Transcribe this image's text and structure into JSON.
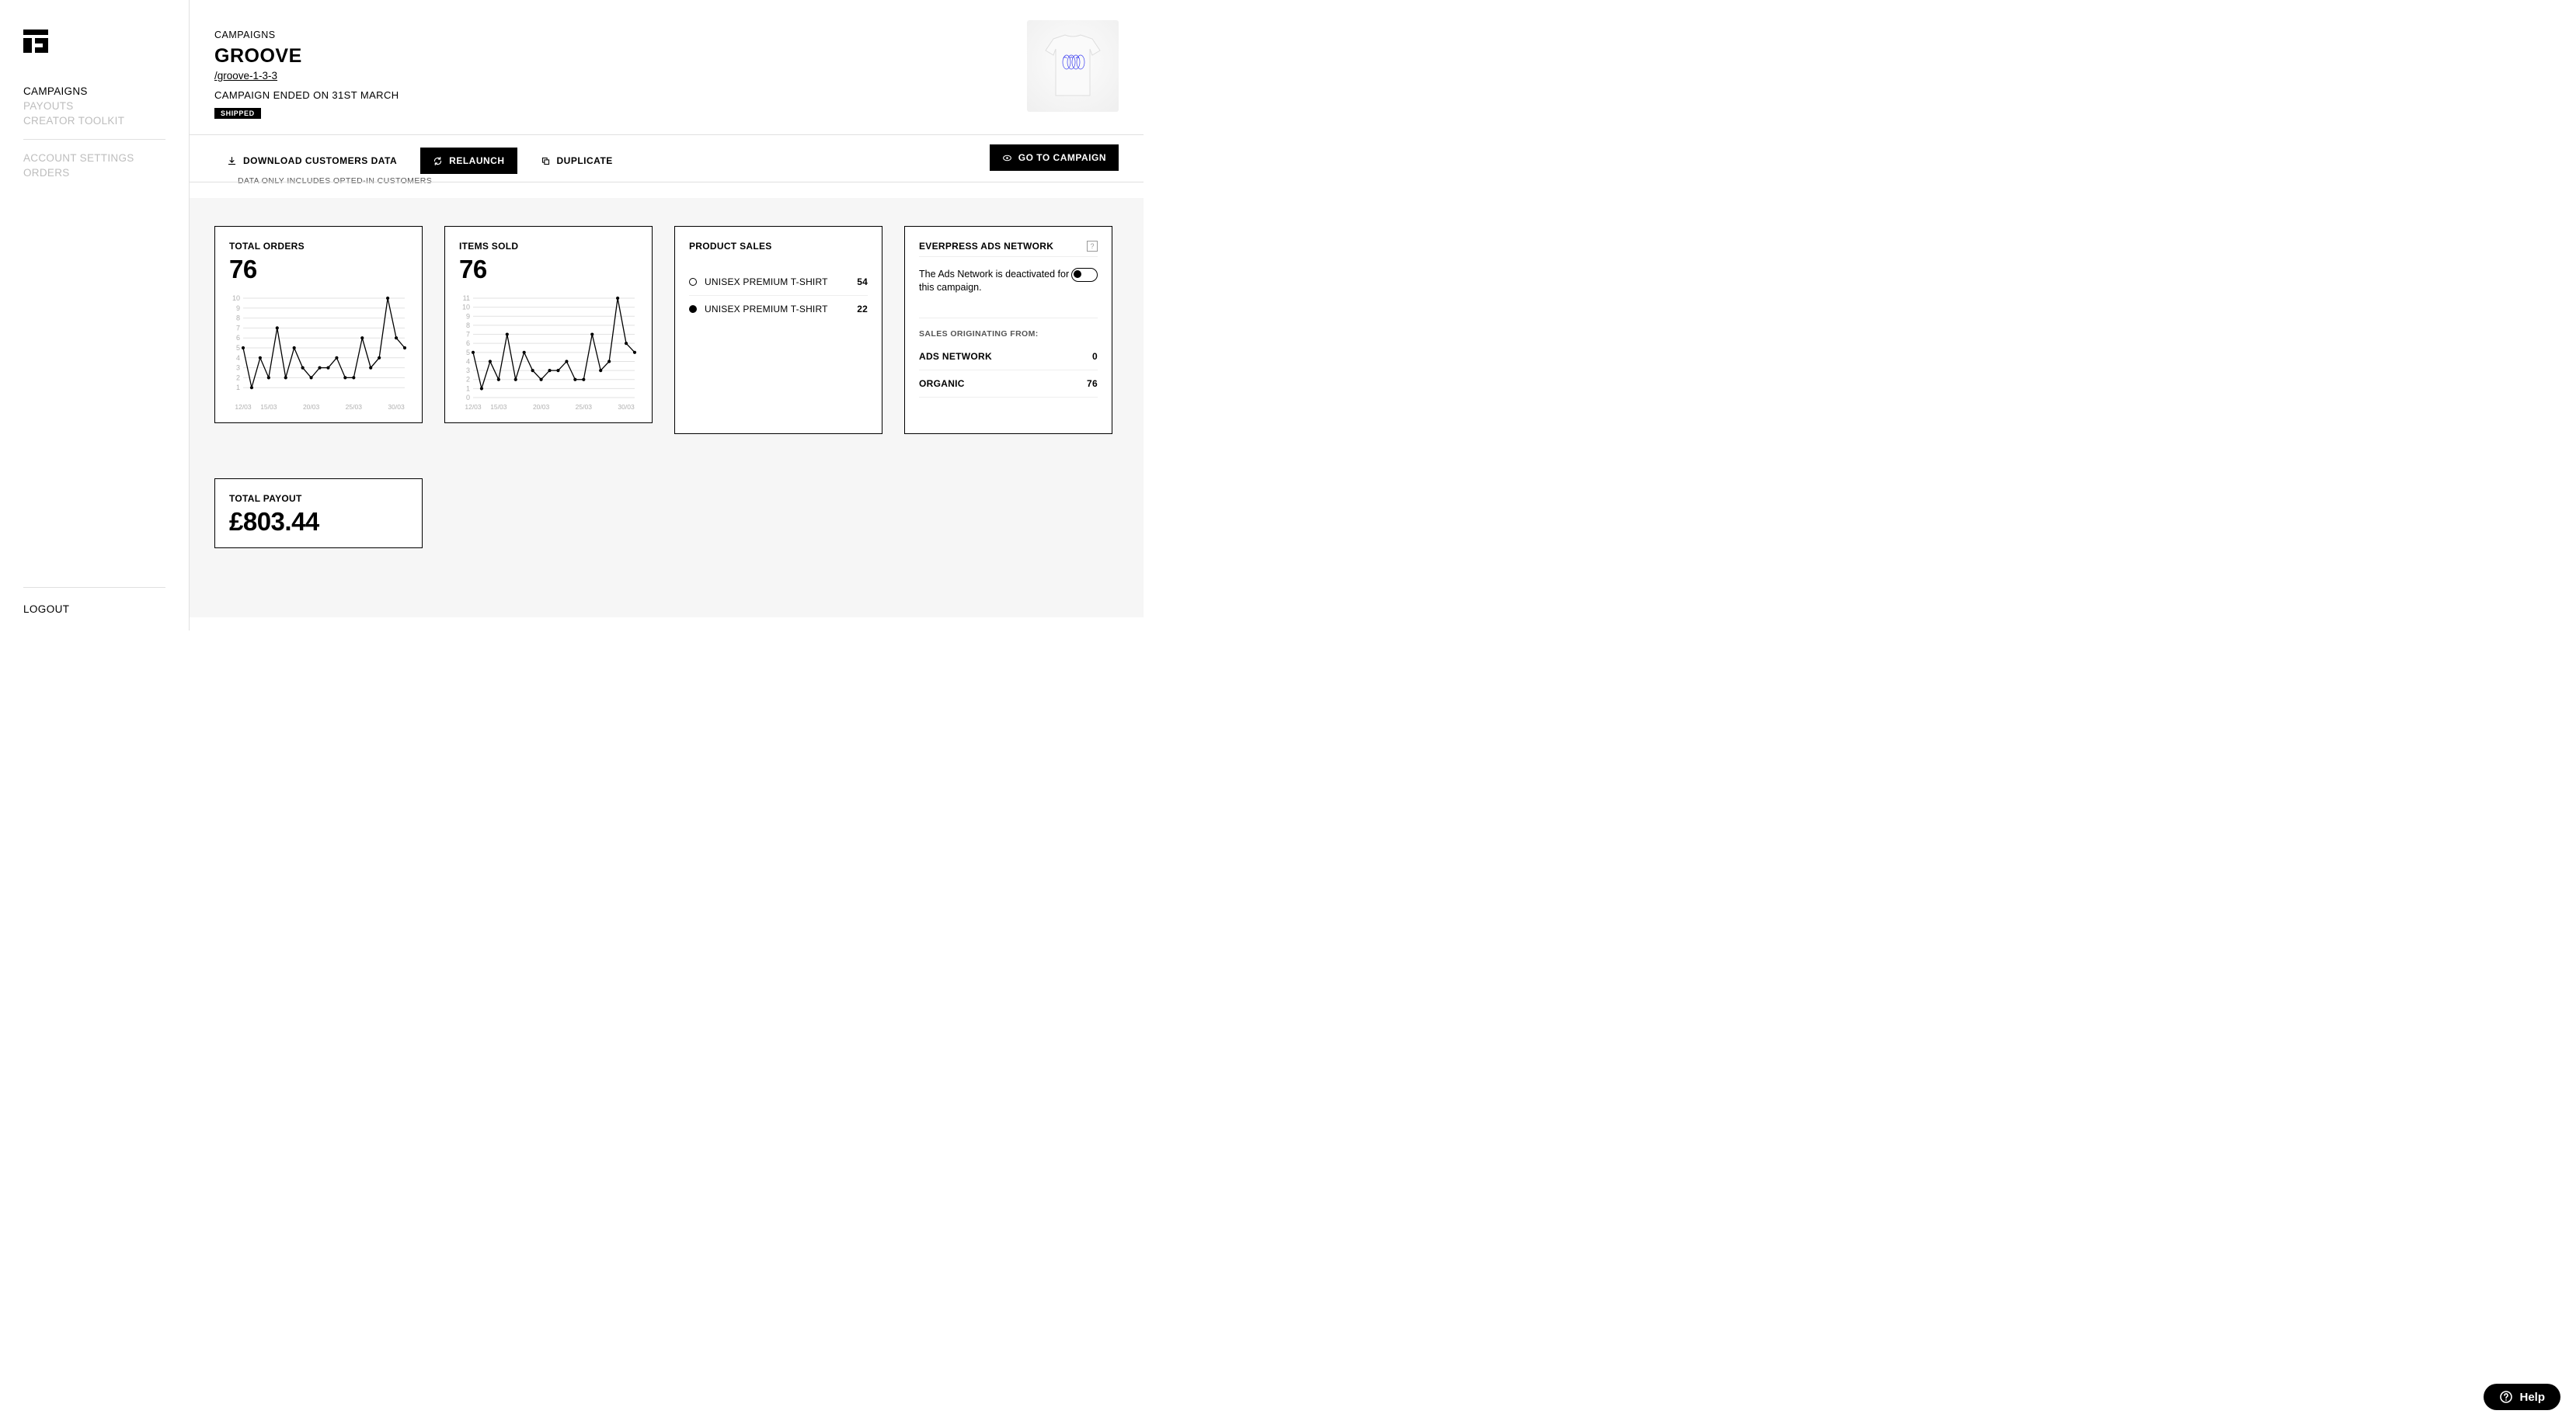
{
  "sidebar": {
    "items": [
      {
        "label": "CAMPAIGNS",
        "active": true
      },
      {
        "label": "PAYOUTS"
      },
      {
        "label": "CREATOR TOOLKIT"
      }
    ],
    "items2": [
      {
        "label": "ACCOUNT SETTINGS"
      },
      {
        "label": "ORDERS"
      }
    ],
    "logout": "LOGOUT"
  },
  "header": {
    "breadcrumb": "CAMPAIGNS",
    "title": "GROOVE",
    "slug": "/groove-1-3-3",
    "ended": "CAMPAIGN ENDED ON 31ST MARCH",
    "badge": "SHIPPED"
  },
  "actions": {
    "download": "DOWNLOAD CUSTOMERS DATA",
    "relaunch": "RELAUNCH",
    "duplicate": "DUPLICATE",
    "goto": "GO TO CAMPAIGN",
    "note": "DATA ONLY INCLUDES OPTED-IN CUSTOMERS"
  },
  "cards": {
    "total_orders": {
      "title": "TOTAL ORDERS",
      "value": "76"
    },
    "items_sold": {
      "title": "ITEMS SOLD",
      "value": "76"
    },
    "product_sales": {
      "title": "PRODUCT SALES",
      "rows": [
        {
          "name": "UNISEX PREMIUM T-SHIRT",
          "qty": "54",
          "filled": false
        },
        {
          "name": "UNISEX PREMIUM T-SHIRT",
          "qty": "22",
          "filled": true
        }
      ]
    },
    "ads": {
      "title": "EVERPRESS ADS NETWORK",
      "desc": "The Ads Network is deactivated for this campaign.",
      "subhead": "SALES ORIGINATING FROM:",
      "rows": [
        {
          "label": "ADS NETWORK",
          "value": "0"
        },
        {
          "label": "ORGANIC",
          "value": "76"
        }
      ]
    },
    "payout": {
      "title": "TOTAL PAYOUT",
      "value": "£803.44"
    }
  },
  "help": {
    "label": "Help"
  },
  "chart_data": [
    {
      "type": "line",
      "title": "TOTAL ORDERS",
      "xlabel": "",
      "ylabel": "",
      "ylim": [
        0,
        10
      ],
      "categories": [
        "12/03",
        "13/03",
        "14/03",
        "15/03",
        "16/03",
        "17/03",
        "18/03",
        "19/03",
        "20/03",
        "21/03",
        "22/03",
        "23/03",
        "24/03",
        "25/03",
        "26/03",
        "27/03",
        "28/03",
        "29/03",
        "30/03",
        "31/03"
      ],
      "x_ticks_shown": [
        "12/03",
        "15/03",
        "20/03",
        "25/03",
        "30/03"
      ],
      "y_ticks_shown": [
        1,
        2,
        3,
        4,
        5,
        6,
        7,
        8,
        9,
        10
      ],
      "values": [
        5,
        1,
        4,
        2,
        7,
        2,
        5,
        3,
        2,
        3,
        3,
        4,
        2,
        2,
        6,
        3,
        4,
        10,
        6,
        5
      ]
    },
    {
      "type": "line",
      "title": "ITEMS SOLD",
      "xlabel": "",
      "ylabel": "",
      "ylim": [
        0,
        11
      ],
      "categories": [
        "12/03",
        "13/03",
        "14/03",
        "15/03",
        "16/03",
        "17/03",
        "18/03",
        "19/03",
        "20/03",
        "21/03",
        "22/03",
        "23/03",
        "24/03",
        "25/03",
        "26/03",
        "27/03",
        "28/03",
        "29/03",
        "30/03",
        "31/03"
      ],
      "x_ticks_shown": [
        "12/03",
        "15/03",
        "20/03",
        "25/03",
        "30/03"
      ],
      "y_ticks_shown": [
        0,
        1,
        2,
        3,
        4,
        5,
        6,
        7,
        8,
        9,
        10,
        11
      ],
      "values": [
        5,
        1,
        4,
        2,
        7,
        2,
        5,
        3,
        2,
        3,
        3,
        4,
        2,
        2,
        7,
        3,
        4,
        11,
        6,
        5
      ]
    }
  ]
}
